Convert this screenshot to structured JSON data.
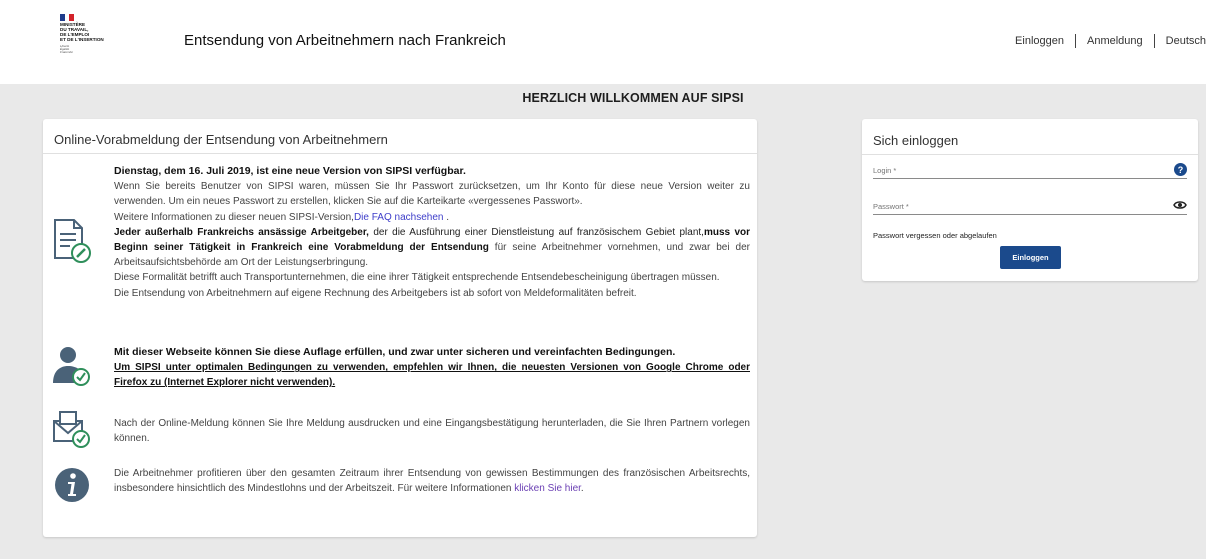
{
  "header": {
    "logo_lines": [
      "MINISTÈRE",
      "DU TRAVAIL,",
      "DE L'EMPLOI",
      "ET DE L'INSERTION"
    ],
    "logo_motto": [
      "Liberté",
      "Égalité",
      "Fraternité"
    ],
    "title": "Entsendung von Arbeitnehmern nach Frankreich",
    "nav": {
      "login": "Einloggen",
      "register": "Anmeldung",
      "language": "Deutsch"
    }
  },
  "welcome": "HERZLICH WILLKOMMEN AUF SIPSI",
  "main": {
    "title": "Online-Vorabmeldung der Entsendung von Arbeitnehmern",
    "news": {
      "head": "Dienstag, dem 16. Juli 2019, ist eine neue Version von SIPSI verfügbar.",
      "p1": "Wenn Sie bereits Benutzer von SIPSI waren, müssen Sie Ihr Passwort zurücksetzen, um Ihr Konto für diese neue Version weiter zu verwenden. Um ein neues Passwort zu erstellen, klicken Sie auf die Karteikarte «vergessenes Passwort».",
      "p2_prefix": "Weitere Informationen zu dieser neuen SIPSI-Version,",
      "p2_link": "Die FAQ nachsehen",
      "p2_suffix": " .",
      "p3_bold1": "Jeder außerhalb Frankreichs ansässige Arbeitgeber,",
      "p3_text1": " der die Ausführung einer Dienstleistung auf französischem Gebiet plant,",
      "p3_bold2": "muss vor Beginn seiner Tätigkeit in Frankreich eine Vorabmeldung der Entsendung",
      "p3_text2": " für seine Arbeitnehmer vornehmen, und zwar bei der Arbeitsaufsichtsbehörde am Ort der Leistungserbringung.",
      "p4": "Diese Formalität betrifft auch Transportunternehmen, die eine ihrer Tätigkeit entsprechende Entsendebescheinigung übertragen müssen.",
      "p5": "Die Entsendung von Arbeitnehmern auf eigene Rechnung des Arbeitgebers ist ab sofort von Meldeformalitäten befreit."
    },
    "secure": {
      "head": "Mit dieser Webseite können Sie diese Auflage erfüllen, und zwar unter sicheren und vereinfachten Bedingungen.",
      "browser": "Um SIPSI unter optimalen Bedingungen zu verwenden, empfehlen wir Ihnen, die neuesten Versionen von Google Chrome oder Firefox zu (Internet Explorer nicht verwenden)."
    },
    "print": "Nach der Online-Meldung können Sie Ihre Meldung ausdrucken und eine Eingangsbestätigung herunterladen, die Sie Ihren Partnern vorlegen können.",
    "info": {
      "text": "Die Arbeitnehmer profitieren über den gesamten Zeitraum ihrer Entsendung von gewissen Bestimmungen des französischen Arbeitsrechts, insbesondere hinsichtlich des Mindestlohns und der Arbeitszeit. Für weitere Informationen ",
      "link": "klicken Sie hier",
      "suffix": "."
    }
  },
  "login": {
    "title": "Sich einloggen",
    "login_placeholder": "Login *",
    "password_placeholder": "Passwort *",
    "forgot": "Passwort vergessen oder abgelaufen",
    "submit": "Einloggen"
  },
  "colors": {
    "primary": "#1b4a8c",
    "background": "#e9e9e9",
    "icon": "#4a6278",
    "check": "#2f8f5b",
    "link": "#3d3dc9"
  }
}
